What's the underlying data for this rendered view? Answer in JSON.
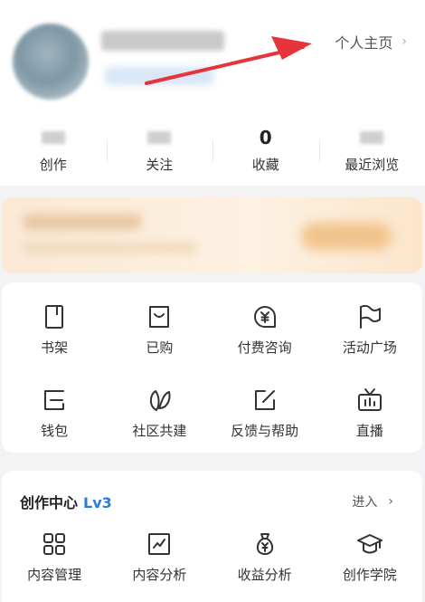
{
  "header": {
    "profile_link": "个人主页",
    "profile_chevron": "›"
  },
  "stats": [
    {
      "value": "",
      "label": "创作"
    },
    {
      "value": "",
      "label": "关注"
    },
    {
      "value": "0",
      "label": "收藏"
    },
    {
      "value": "",
      "label": "最近浏览"
    }
  ],
  "menu": [
    {
      "label": "书架",
      "icon": "bookshelf-icon"
    },
    {
      "label": "已购",
      "icon": "shopping-bag-icon"
    },
    {
      "label": "付费咨询",
      "icon": "paid-consult-icon"
    },
    {
      "label": "活动广场",
      "icon": "flag-icon"
    },
    {
      "label": "钱包",
      "icon": "wallet-icon"
    },
    {
      "label": "社区共建",
      "icon": "leaf-icon"
    },
    {
      "label": "反馈与帮助",
      "icon": "edit-icon"
    },
    {
      "label": "直播",
      "icon": "tv-icon"
    }
  ],
  "creation": {
    "title": "创作中心",
    "level": "Lv3",
    "enter_label": "进入",
    "enter_chevron": "›",
    "items": [
      {
        "label": "内容管理",
        "icon": "grid-icon"
      },
      {
        "label": "内容分析",
        "icon": "chart-icon"
      },
      {
        "label": "收益分析",
        "icon": "money-bag-icon"
      },
      {
        "label": "创作学院",
        "icon": "graduation-cap-icon"
      }
    ]
  },
  "colors": {
    "accent": "#2c7bd9",
    "annotation": "#e5343b"
  }
}
